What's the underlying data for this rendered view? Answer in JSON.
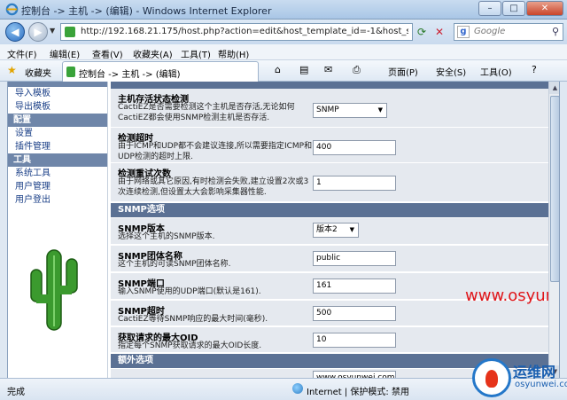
{
  "window": {
    "title": "控制台 -> 主机 -> (编辑) - Windows Internet Explorer",
    "buttons": {
      "minimize": "–",
      "maximize": "□",
      "close": "✕"
    }
  },
  "address_bar": {
    "url": "http://192.168.21.175/host.php?action=edit&host_template_id=-1&host_status",
    "search_placeholder": "Google",
    "search_engine_letter": "g"
  },
  "menu": [
    "文件(F)",
    "编辑(E)",
    "查看(V)",
    "收藏夹(A)",
    "工具(T)",
    "帮助(H)"
  ],
  "favorites_bar": {
    "label": "收藏夹",
    "tab_title": "控制台 -> 主机 -> (编辑)",
    "commands": {
      "page": "页面(P)",
      "safety": "安全(S)",
      "tools": "工具(O)"
    }
  },
  "sidebar": {
    "items_top": [
      "导入模板",
      "导出模板"
    ],
    "section_config": "配置",
    "items_config": [
      "设置",
      "插件管理"
    ],
    "section_tools": "工具",
    "items_tools": [
      "系统工具",
      "用户管理",
      "用户登出"
    ]
  },
  "form": {
    "rows": [
      {
        "title": "主机存活状态检测",
        "desc": "CactiEZ是否需要检测这个主机是否存活,无论如何CactiEZ都会使用SNMP检测主机是否存活.",
        "value": "SNMP",
        "kind": "select"
      },
      {
        "title": "检测超时",
        "desc": "由于ICMP和UDP都不会建议连接,所以需要指定ICMP和UDP检测的超时上限.",
        "value": "400",
        "kind": "text"
      },
      {
        "title": "检测重试次数",
        "desc": "由于网络或其它原因,有时检测会失败,建立设置2次或3次连续检测,但设置太大会影响采集器性能.",
        "value": "1",
        "kind": "text"
      }
    ],
    "section_snmp": "SNMP选项",
    "snmp_rows": [
      {
        "title": "SNMP版本",
        "desc": "选择这个主机的SNMP版本.",
        "value": "版本2",
        "kind": "select"
      },
      {
        "title": "SNMP团体名称",
        "desc": "这个主机的可读SNMP团体名称.",
        "value": "public",
        "kind": "text"
      },
      {
        "title": "SNMP端口",
        "desc": "输入SNMP使用的UDP端口(默认是161).",
        "value": "161",
        "kind": "text"
      },
      {
        "title": "SNMP超时",
        "desc": "CactiEZ等待SNMP响应的最大时间(毫秒).",
        "value": "500",
        "kind": "text"
      },
      {
        "title": "获取请求的最大OID",
        "desc": "指定每个SNMP获取请求的最大OID长度.",
        "value": "10",
        "kind": "text"
      }
    ],
    "section_extra": "额外选项",
    "extra_field_value": "www.osyunwei.com"
  },
  "watermark": "www.osyunwei.com",
  "status_bar": {
    "status": "完成",
    "zone": "Internet | 保护模式: 禁用"
  },
  "logo": {
    "cn": "运维网",
    "en": "osyunwei.com"
  },
  "colors": {
    "section_header": "#5b7194",
    "row_bg": "#e5e9ef",
    "watermark": "#e0161a"
  }
}
